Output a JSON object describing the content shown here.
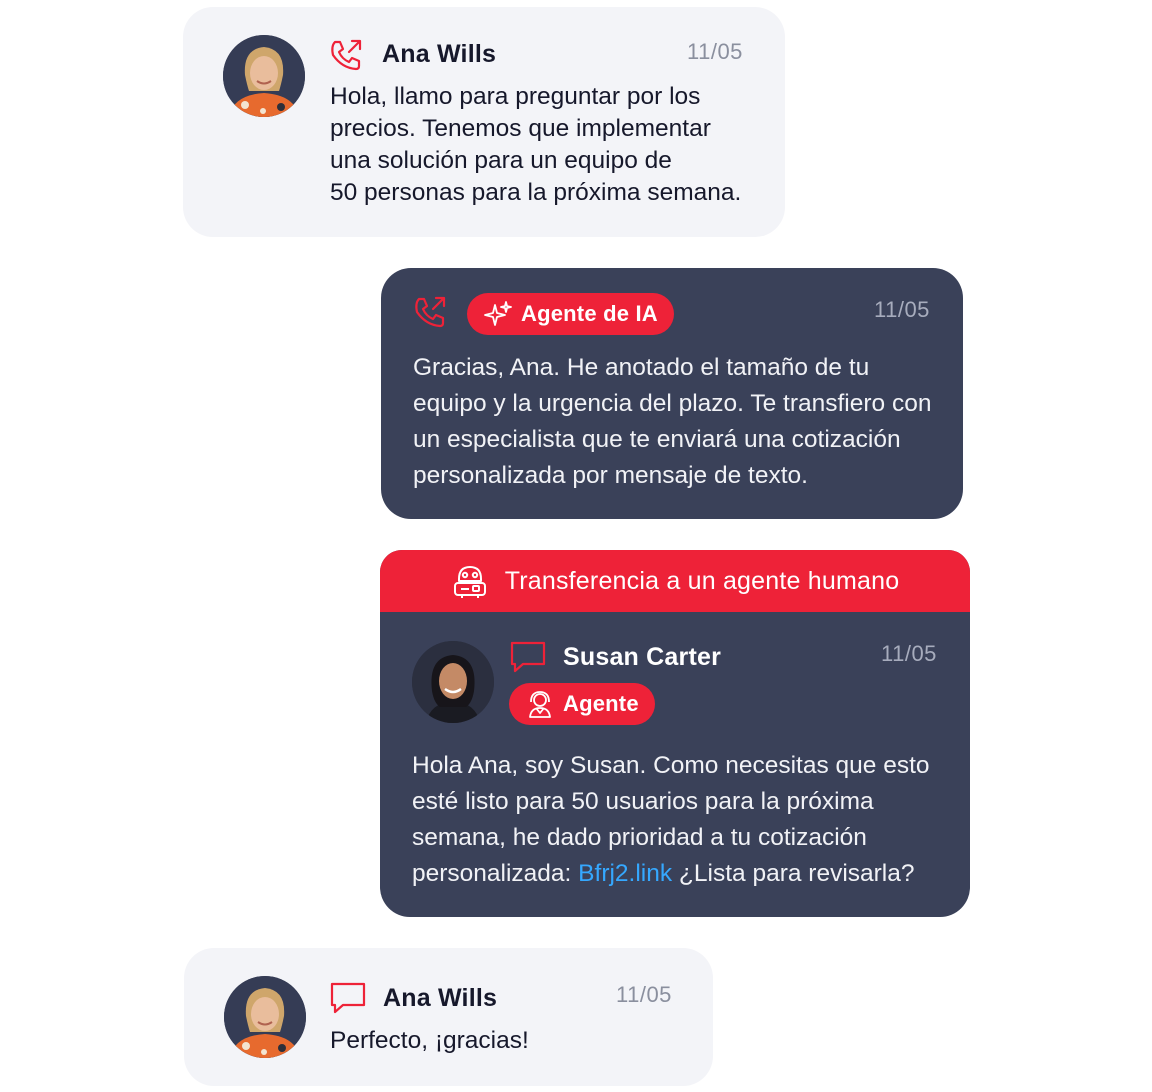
{
  "colors": {
    "accent": "#ee2238",
    "dark_card": "#3a4159",
    "light_card": "#f3f4f8",
    "link": "#35a8ff"
  },
  "messages": [
    {
      "sender": "Ana Wills",
      "channel_icon": "phone-call-icon",
      "date": "11/05",
      "lines": [
        "Hola, llamo para preguntar por los",
        "precios. Tenemos que implementar",
        "una solución para un equipo de",
        "50 personas para la próxima semana."
      ]
    },
    {
      "badge": "Agente de IA",
      "badge_icon": "sparkle-icon",
      "channel_icon": "phone-call-icon",
      "date": "11/05",
      "lines": [
        "Gracias, Ana. He anotado el tamaño de tu",
        "equipo y la urgencia del plazo. Te transfiero con",
        "un especialista que te enviará una cotización",
        "personalizada por mensaje de texto."
      ]
    },
    {
      "banner": "Transferencia a un agente humano",
      "banner_icon": "robot-icon",
      "sender": "Susan Carter",
      "badge": "Agente",
      "badge_icon": "agent-headset-icon",
      "channel_icon": "chat-bubble-icon",
      "date": "11/05",
      "lines": [
        "Hola Ana, soy Susan. Como necesitas que esto",
        "esté listo para 50 usuarios para la próxima",
        "semana, he dado prioridad a tu cotización"
      ],
      "last_line_prefix": "personalizada: ",
      "link": "Bfrj2.link",
      "last_line_suffix": " ¿Lista para revisarla?"
    },
    {
      "sender": "Ana Wills",
      "channel_icon": "chat-bubble-icon",
      "date": "11/05",
      "lines": [
        "Perfecto, ¡gracias!"
      ]
    }
  ]
}
